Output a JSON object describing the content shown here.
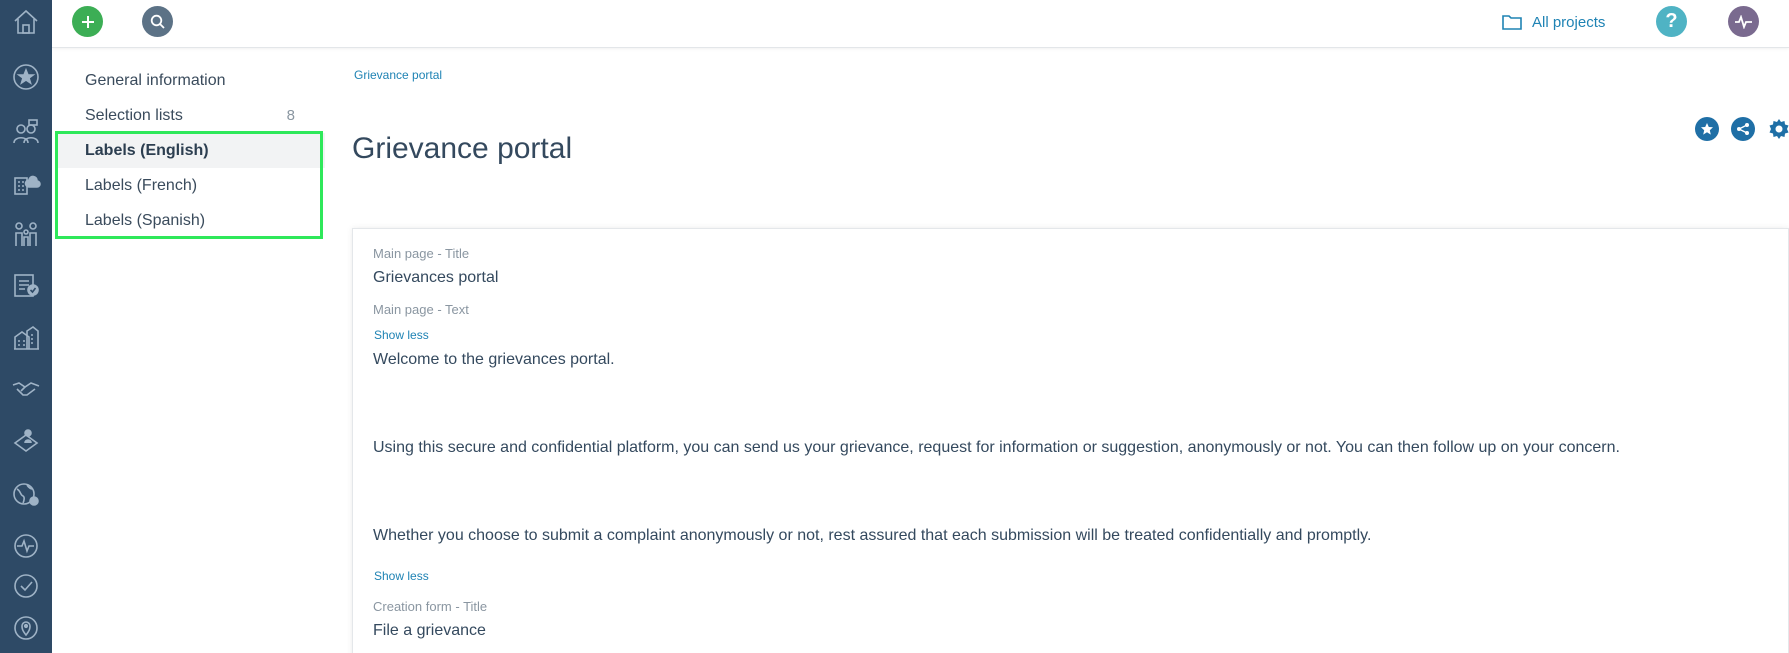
{
  "topbar": {
    "add_icon": "plus-icon",
    "search_icon": "search-icon",
    "all_projects_label": "All projects",
    "help_label": "?",
    "activity_icon": "activity-icon"
  },
  "rail": {
    "items": [
      "home-icon",
      "star-icon",
      "people-icon",
      "building-cloud-icon",
      "family-icon",
      "checklist-icon",
      "buildings-icon",
      "handshake-icon",
      "location-person-icon",
      "globe-icon",
      "activity-icon",
      "check-circle-icon",
      "location-pin-icon"
    ]
  },
  "sidenav": {
    "items": [
      {
        "label": "General information",
        "count": ""
      },
      {
        "label": "Selection lists",
        "count": "8"
      },
      {
        "label": "Labels (English)",
        "count": ""
      },
      {
        "label": "Labels (French)",
        "count": ""
      },
      {
        "label": "Labels (Spanish)",
        "count": ""
      }
    ]
  },
  "main": {
    "breadcrumb": "Grievance portal",
    "title": "Grievance portal",
    "actions": [
      "star-icon",
      "share-icon",
      "gear-icon"
    ]
  },
  "card": {
    "title_label": "Main page - Title",
    "title_value": "Grievances portal",
    "text_label": "Main page - Text",
    "show_less_1": "Show less",
    "paragraph_1": "Welcome to the grievances portal.",
    "paragraph_2": "Using this secure and confidential platform, you can send us your grievance, request for information or suggestion, anonymously or not. You can then follow up on your concern.",
    "paragraph_3": "Whether you choose to submit a complaint anonymously or not, rest assured that each submission will be treated confidentially and promptly.",
    "show_less_2": "Show less",
    "form_title_label": "Creation form - Title",
    "form_title_value": "File a grievance"
  },
  "colors": {
    "rail_bg": "#2e4a66",
    "accent": "#1f83b4",
    "add_green": "#3cae55",
    "highlight": "#2ee85a"
  }
}
